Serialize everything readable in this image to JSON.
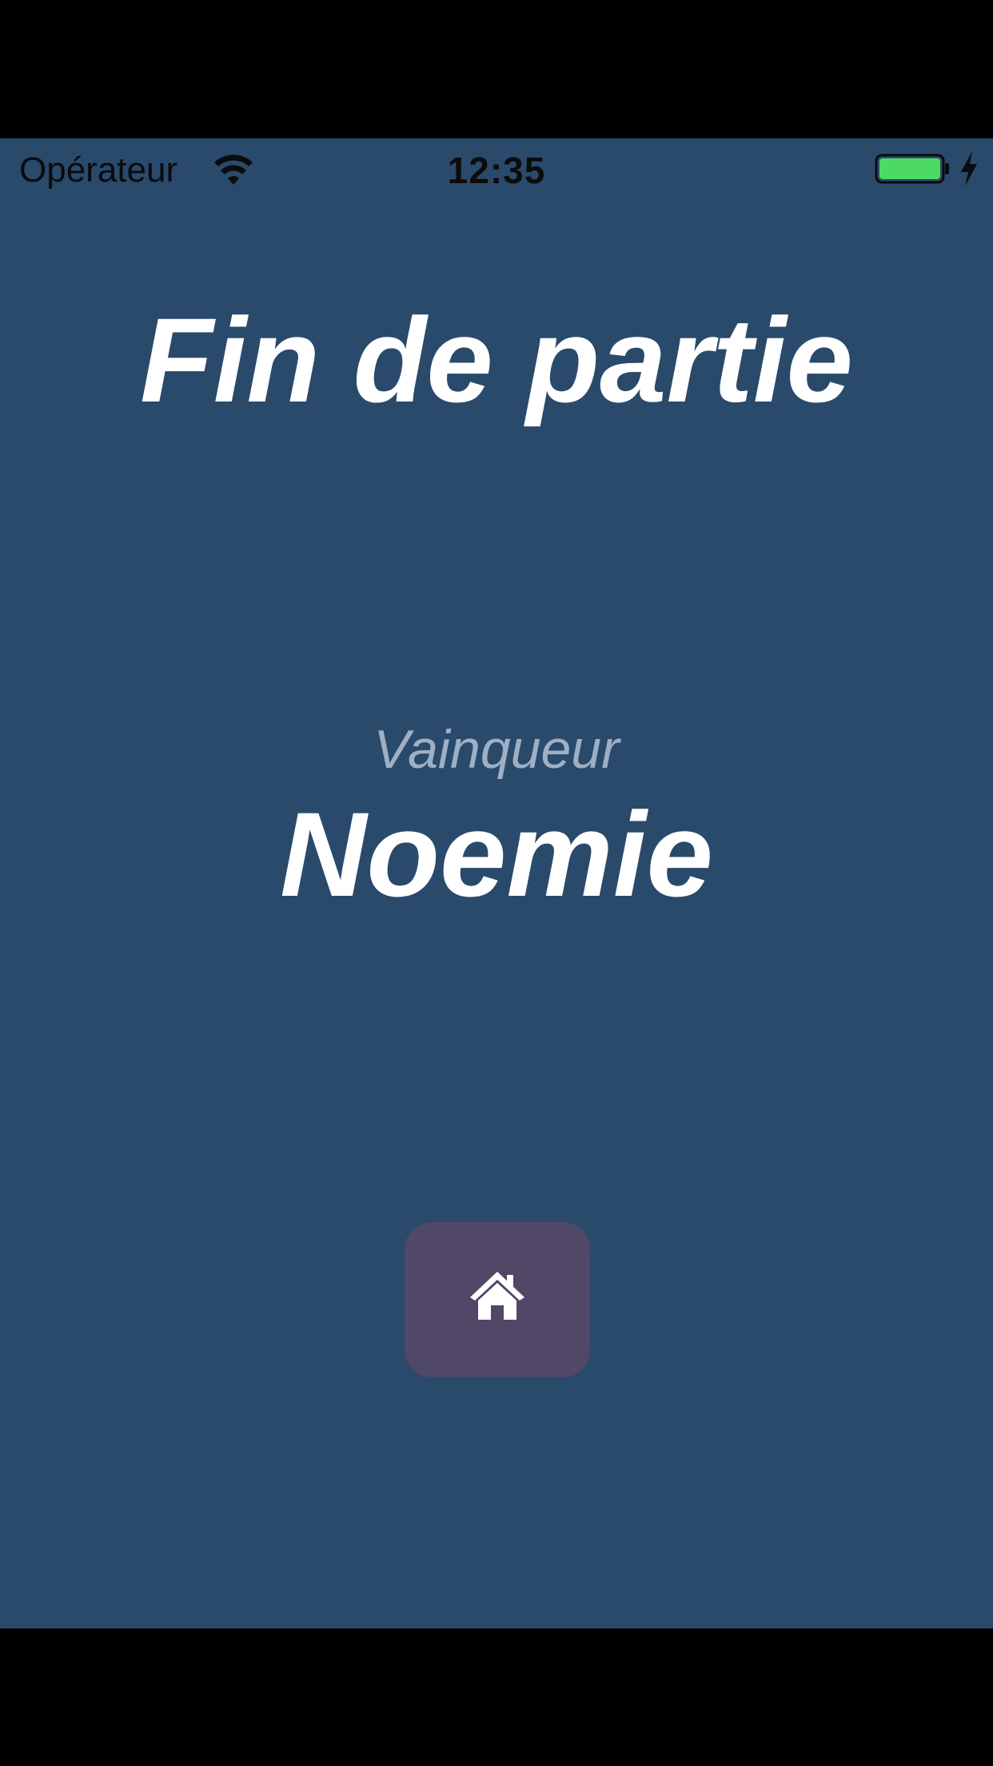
{
  "status_bar": {
    "carrier": "Opérateur",
    "time": "12:35",
    "battery_color": "#4cd964",
    "icons": [
      "wifi-icon",
      "battery-icon",
      "charging-bolt-icon"
    ]
  },
  "game_over": {
    "title": "Fin de partie",
    "winner_label": "Vainqueur",
    "winner_name": "Noemie"
  },
  "home_button": {
    "icon": "home-icon",
    "background": "#514767"
  },
  "colors": {
    "screen_background": "#2a4a6c",
    "text_primary": "#ffffff",
    "text_secondary": "#9fb0c4"
  }
}
